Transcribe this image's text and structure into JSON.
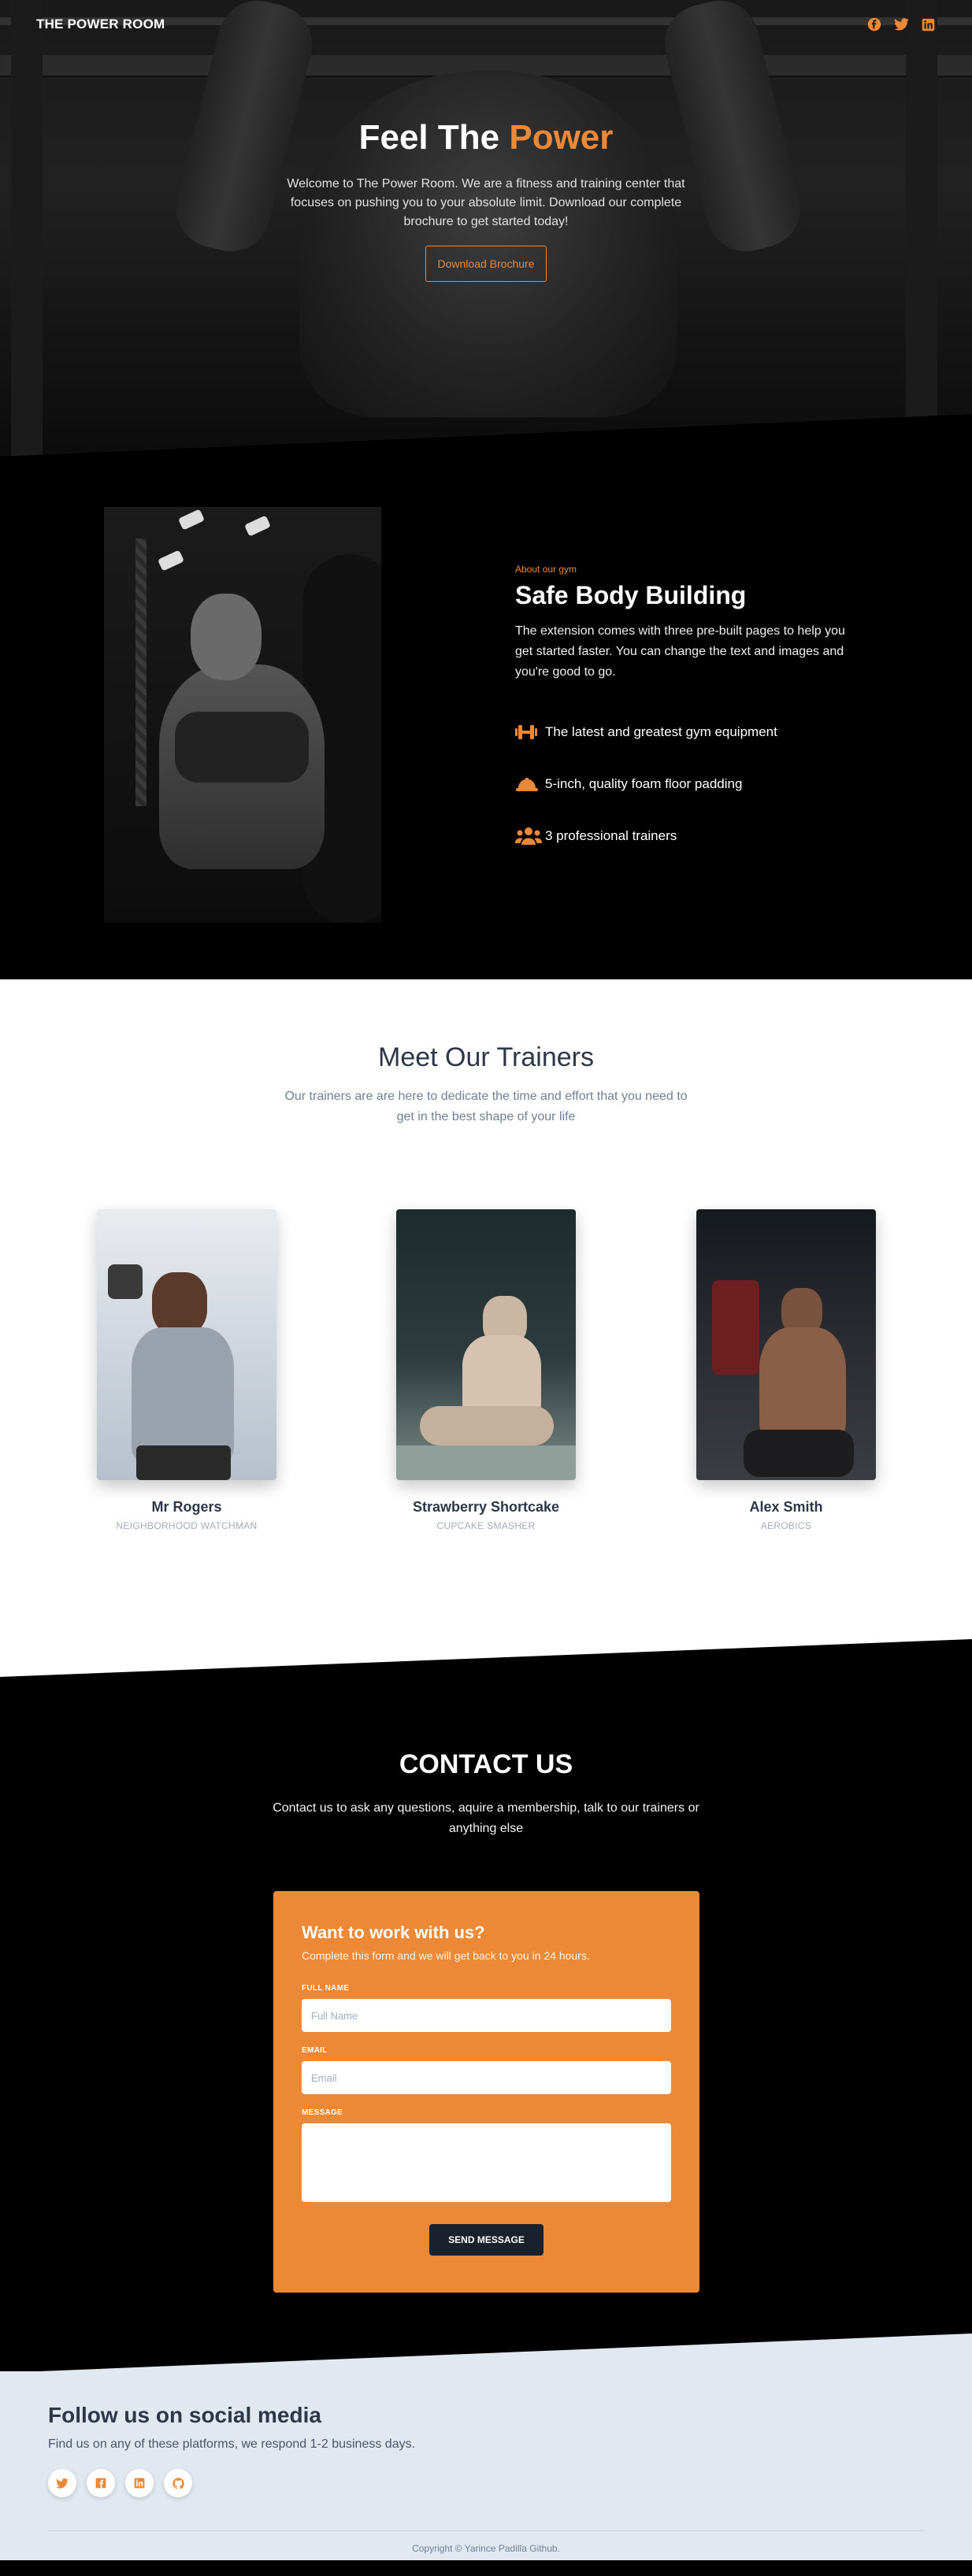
{
  "nav": {
    "brand": "THE POWER ROOM",
    "icons": [
      "facebook-icon",
      "twitter-icon",
      "linkedin-icon"
    ]
  },
  "hero": {
    "title_plain": "Feel The",
    "title_accent": "Power",
    "text": "Welcome to The Power Room. We are a fitness and training center that focuses on pushing you to your absolute limit. Download our complete brochure to get started today!",
    "button": "Download Brochure"
  },
  "about": {
    "eyebrow": "About our gym",
    "title": "Safe Body Building",
    "description": "The extension comes with three pre-built pages to help you get started faster. You can change the text and images and you're good to go.",
    "features": [
      {
        "icon": "dumbbell-icon",
        "label": "The latest and greatest gym equipment"
      },
      {
        "icon": "hard-hat-icon",
        "label": "5-inch, quality foam floor padding"
      },
      {
        "icon": "users-icon",
        "label": "3 professional trainers"
      }
    ]
  },
  "trainers": {
    "title": "Meet Our Trainers",
    "subtitle": "Our trainers are are here to dedicate the time and effort that you need to get in the best shape of your life",
    "people": [
      {
        "name": "Mr Rogers",
        "role": "Neighborhood Watchman"
      },
      {
        "name": "Strawberry Shortcake",
        "role": "Cupcake Smasher"
      },
      {
        "name": "Alex Smith",
        "role": "Aerobics"
      }
    ]
  },
  "contact": {
    "title": "CONTACT US",
    "subtitle": "Contact us to ask any questions, aquire a membership, talk to our trainers or anything else",
    "form": {
      "title": "Want to work with us?",
      "subtitle": "Complete this form and we will get back to you in 24 hours.",
      "full_name_label": "Full Name",
      "full_name_placeholder": "Full Name",
      "email_label": "Email",
      "email_placeholder": "Email",
      "message_label": "Message",
      "send": "Send Message"
    }
  },
  "footer": {
    "title": "Follow us on social media",
    "subtitle": "Find us on any of these platforms, we respond 1-2 business days.",
    "social_icons": [
      "twitter-icon",
      "facebook-icon",
      "linkedin-icon",
      "github-icon"
    ],
    "copyright": "Copyright © Yarince Padilla Github."
  },
  "colors": {
    "accent": "#ed8936",
    "dark": "#000000",
    "light_section": "#ffffff",
    "footer_bg": "#e2e8f0",
    "button_dark": "#1a202c"
  }
}
